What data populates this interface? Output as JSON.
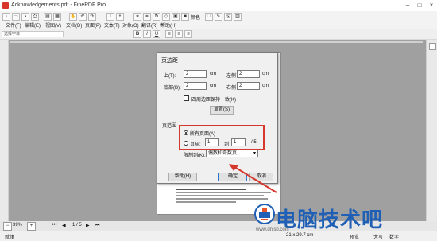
{
  "window": {
    "title": "Acknowledgements.pdf - FinePDF Pro"
  },
  "menubar": {
    "items": [
      "文件(F)",
      "编辑(E)",
      "视图(V)",
      "文档(D)",
      "页面(P)",
      "文本(T)",
      "对象(O)",
      "翻译(R)",
      "帮助(H)"
    ],
    "color_label": "颜色"
  },
  "toolbar2": {
    "font_placeholder": "选择字体"
  },
  "dialog": {
    "title": "页边距",
    "top_label": "上(T):",
    "top_value": "2",
    "top_unit": "cm",
    "left_label": "左侧",
    "left_value": "2",
    "left_unit": "cm",
    "bottom_label": "底部(B):",
    "bottom_value": "2",
    "bottom_unit": "cm",
    "right_label": "右侧",
    "right_value": "2",
    "right_unit": "cm",
    "keep_same_label": "四周边距保持一致(K)",
    "reset_label": "重置(S)",
    "range_label": "页范围",
    "all_pages_label": "所有页面(A)",
    "pages_label": "页从:",
    "from_value": "1",
    "to_label": "到",
    "to_value": "1",
    "total_label": "/ 5",
    "limit_label": "限制到(K):",
    "limit_value": "偶数和奇数页",
    "help_label": "帮助(H)",
    "ok_label": "确定",
    "cancel_label": "取消"
  },
  "status": {
    "ready": "就绪",
    "zoom": "39%",
    "page_indicator": "1 / 5",
    "page_size": "21 x 29.7 cm",
    "preview": "预览",
    "size_a": "大写",
    "size_b": "数字"
  },
  "watermark": {
    "text": "电脑技术吧",
    "url": "www.dnjsb.com"
  }
}
